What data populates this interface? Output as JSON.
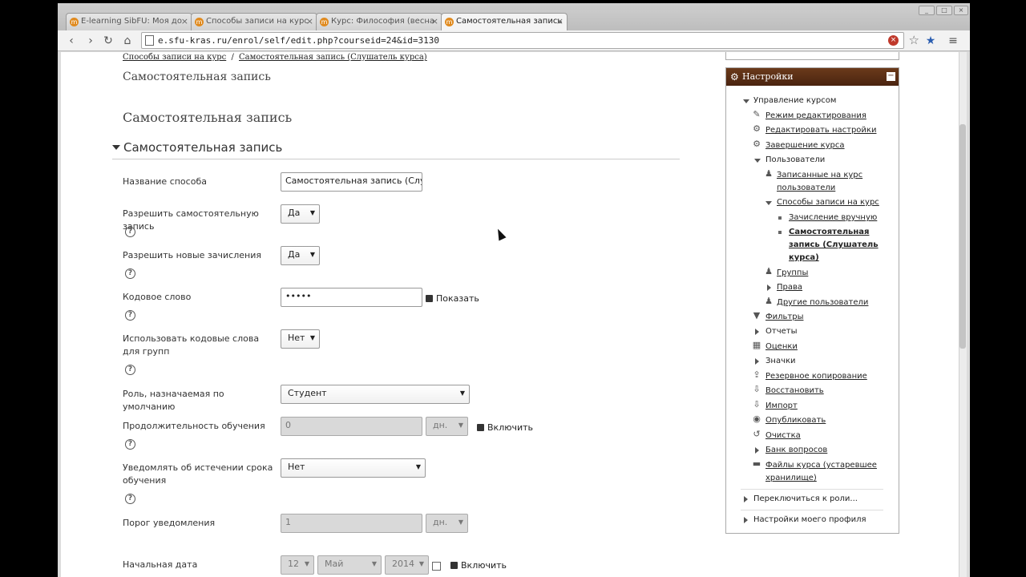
{
  "browser": {
    "tabs": [
      {
        "label": "E-learning SibFU: Моя до",
        "active": false
      },
      {
        "label": "Способы записи на курс",
        "active": false
      },
      {
        "label": "Курс: Философия (весна",
        "active": false
      },
      {
        "label": "Самостоятельная запись",
        "active": true
      }
    ],
    "url": "e.sfu-kras.ru/enrol/self/edit.php?courseid=24&id=3130"
  },
  "breadcrumb": {
    "item1": "Способы записи на курс",
    "separator": "/",
    "item2": "Самостоятельная запись (Слушатель курса)"
  },
  "page": {
    "heading1": "Самостоятельная запись",
    "heading2": "Самостоятельная запись",
    "legend": "Самостоятельная запись"
  },
  "form": {
    "method_name_label": "Название способа",
    "method_name_value": "Самостоятельная запись (Слушатель курса)",
    "allow_self_label": "Разрешить самостоятельную запись",
    "allow_self_value": "Да",
    "allow_new_label": "Разрешить новые зачисления",
    "allow_new_value": "Да",
    "keyword_label": "Кодовое слово",
    "keyword_value": "•••••",
    "show_label": "Показать",
    "group_keys_label": "Использовать кодовые слова для групп",
    "group_keys_value": "Нет",
    "default_role_label": "Роль, назначаемая по умолчанию",
    "default_role_value": "Студент",
    "duration_label": "Продолжительность обучения",
    "duration_value": "0",
    "duration_unit": "дн.",
    "enable_label": "Включить",
    "notify_label": "Уведомлять об истечении срока обучения",
    "notify_value": "Нет",
    "threshold_label": "Порог уведомления",
    "threshold_value": "1",
    "threshold_unit": "дн.",
    "start_label": "Начальная дата",
    "start_day": "12",
    "start_month": "Май",
    "start_year": "2014",
    "start_enable_label": "Включить",
    "help_glyph": "?"
  },
  "settings_block": {
    "title": "Настройки",
    "course_admin": "Управление курсом",
    "edit_mode": "Режим редактирования",
    "edit_settings": "Редактировать настройки",
    "completion": "Завершение курса",
    "users": "Пользователи",
    "enrolled_users_1": "Записанные на курс",
    "enrolled_users_2": "пользователи",
    "enrol_methods": "Способы записи на курс",
    "manual_enrol": "Зачисление вручную",
    "self_enrol_1": "Самостоятельная",
    "self_enrol_2": "запись (Слушатель",
    "self_enrol_3": "курса)",
    "groups": "Группы",
    "permissions": "Права",
    "other_users": "Другие пользователи",
    "filters": "Фильтры",
    "reports": "Отчеты",
    "grades": "Оценки",
    "badges": "Значки",
    "backup": "Резервное копирование",
    "restore": "Восстановить",
    "import": "Импорт",
    "publish": "Опубликовать",
    "reset": "Очистка",
    "question_bank": "Банк вопросов",
    "files_1": "Файлы курса (устаревшее",
    "files_2": "хранилище)",
    "switch_role": "Переключиться к роли...",
    "my_profile": "Настройки моего профиля"
  }
}
